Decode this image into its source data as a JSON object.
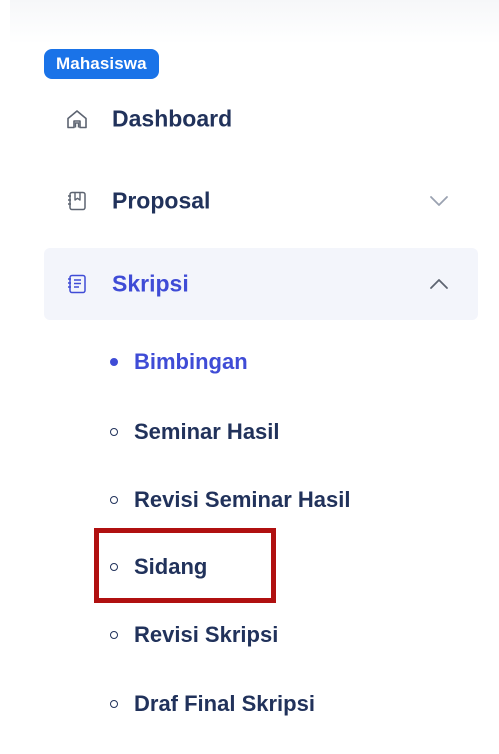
{
  "sidebar": {
    "role_badge": "Mahasiswa",
    "menu": [
      {
        "label": "Dashboard",
        "icon": "home-icon",
        "active": false,
        "chevron": "none"
      },
      {
        "label": "Proposal",
        "icon": "book-icon",
        "active": false,
        "chevron": "chevron-down-icon"
      },
      {
        "label": "Skripsi",
        "icon": "notebook-icon",
        "active": true,
        "chevron": "chevron-up-icon"
      }
    ],
    "submenu": [
      {
        "label": "Bimbingan",
        "active": true
      },
      {
        "label": "Seminar Hasil",
        "active": false
      },
      {
        "label": "Revisi Seminar Hasil",
        "active": false
      },
      {
        "label": "Sidang",
        "active": false,
        "highlighted": true
      },
      {
        "label": "Revisi Skripsi",
        "active": false
      },
      {
        "label": "Draf Final Skripsi",
        "active": false
      }
    ]
  },
  "colors": {
    "badge_bg": "#1a73e8",
    "text": "#21325b",
    "active_text": "#3f4cd6",
    "active_bg": "#f3f5fb",
    "highlight_border": "#b01010"
  }
}
